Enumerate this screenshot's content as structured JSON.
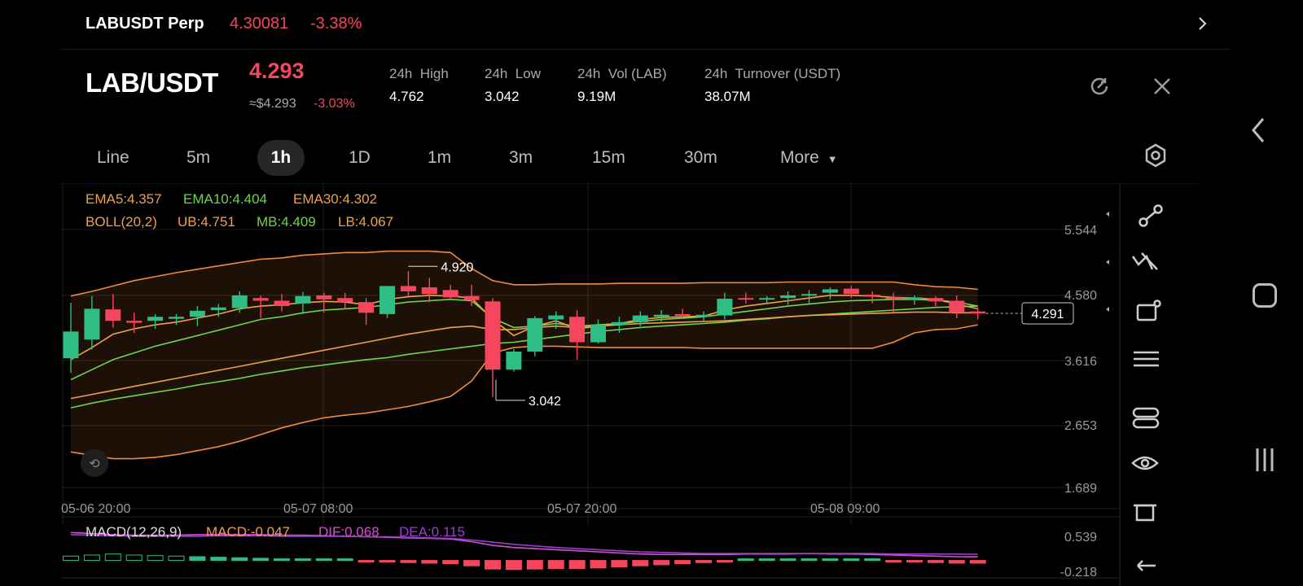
{
  "ticker": {
    "symbol": "LABUSDT Perp",
    "price": "4.30081",
    "change": "-3.38%"
  },
  "header": {
    "pair": "LAB/USDT",
    "last_price": "4.293",
    "approx_usd": "≈$4.293",
    "change": "-3.03%",
    "stats": [
      {
        "label": "24h  High",
        "value": "4.762"
      },
      {
        "label": "24h  Low",
        "value": "3.042"
      },
      {
        "label": "24h  Vol (LAB)",
        "value": "9.19M"
      },
      {
        "label": "24h  Turnover (USDT)",
        "value": "38.07M"
      }
    ]
  },
  "timeframes": [
    "Line",
    "5m",
    "1h",
    "1D",
    "1m",
    "3m",
    "15m",
    "30m",
    "More"
  ],
  "active_timeframe": "1h",
  "indicators": {
    "ema5": "EMA5:4.357",
    "ema10": "EMA10:4.404",
    "ema30": "EMA30:4.302",
    "boll": "BOLL(20,2)",
    "ub": "UB:4.751",
    "mb": "MB:4.409",
    "lb": "LB:4.067"
  },
  "macd": {
    "name": "MACD(12,26,9)",
    "macd": "MACD:-0.047",
    "dif": "DIF:0.068",
    "dea": "DEA:0.115"
  },
  "colors": {
    "up": "#2ebd85",
    "down": "#f6465d",
    "ema5": "#f0a04b",
    "ema10": "#6fd34d",
    "ema30": "#f0a04b",
    "boll": "#f08a3c",
    "dif": "#d24fd2",
    "dea": "#9a3fd0"
  },
  "chart_data": {
    "type": "candlestick",
    "y_axis_ticks": [
      "5.544",
      "4.580",
      "3.616",
      "2.653",
      "1.689"
    ],
    "ylim": [
      1.689,
      5.544
    ],
    "x_axis_ticks": [
      "05-06 20:00",
      "05-07 08:00",
      "05-07 20:00",
      "05-08 09:00"
    ],
    "current_price": "4.291",
    "high_marker": "4.920",
    "low_marker": "3.042",
    "macd_axis_ticks": [
      "0.539",
      "-0.218"
    ],
    "candles": [
      {
        "o": 3.62,
        "h": 4.45,
        "l": 3.4,
        "c": 4.02
      },
      {
        "o": 3.9,
        "h": 4.55,
        "l": 3.75,
        "c": 4.36
      },
      {
        "o": 4.35,
        "h": 4.58,
        "l": 4.08,
        "c": 4.18
      },
      {
        "o": 4.18,
        "h": 4.3,
        "l": 4.0,
        "c": 4.15
      },
      {
        "o": 4.18,
        "h": 4.28,
        "l": 4.06,
        "c": 4.24
      },
      {
        "o": 4.21,
        "h": 4.28,
        "l": 4.12,
        "c": 4.24
      },
      {
        "o": 4.24,
        "h": 4.4,
        "l": 4.1,
        "c": 4.33
      },
      {
        "o": 4.34,
        "h": 4.43,
        "l": 4.24,
        "c": 4.38
      },
      {
        "o": 4.37,
        "h": 4.62,
        "l": 4.3,
        "c": 4.56
      },
      {
        "o": 4.52,
        "h": 4.56,
        "l": 4.22,
        "c": 4.48
      },
      {
        "o": 4.48,
        "h": 4.58,
        "l": 4.32,
        "c": 4.4
      },
      {
        "o": 4.44,
        "h": 4.61,
        "l": 4.28,
        "c": 4.55
      },
      {
        "o": 4.56,
        "h": 4.6,
        "l": 4.3,
        "c": 4.5
      },
      {
        "o": 4.52,
        "h": 4.6,
        "l": 4.36,
        "c": 4.46
      },
      {
        "o": 4.46,
        "h": 4.52,
        "l": 4.12,
        "c": 4.3
      },
      {
        "o": 4.28,
        "h": 4.7,
        "l": 4.22,
        "c": 4.7
      },
      {
        "o": 4.7,
        "h": 4.92,
        "l": 4.55,
        "c": 4.62
      },
      {
        "o": 4.68,
        "h": 4.82,
        "l": 4.46,
        "c": 4.58
      },
      {
        "o": 4.64,
        "h": 4.72,
        "l": 4.5,
        "c": 4.53
      },
      {
        "o": 4.55,
        "h": 4.72,
        "l": 4.4,
        "c": 4.49
      },
      {
        "o": 4.47,
        "h": 4.52,
        "l": 3.04,
        "c": 3.45
      },
      {
        "o": 3.45,
        "h": 3.76,
        "l": 3.42,
        "c": 3.72
      },
      {
        "o": 3.72,
        "h": 4.25,
        "l": 3.65,
        "c": 4.22
      },
      {
        "o": 4.2,
        "h": 4.32,
        "l": 4.06,
        "c": 4.26
      },
      {
        "o": 4.24,
        "h": 4.34,
        "l": 3.6,
        "c": 3.86
      },
      {
        "o": 3.86,
        "h": 4.2,
        "l": 3.84,
        "c": 4.12
      },
      {
        "o": 4.12,
        "h": 4.24,
        "l": 4.0,
        "c": 4.16
      },
      {
        "o": 4.16,
        "h": 4.32,
        "l": 4.1,
        "c": 4.26
      },
      {
        "o": 4.24,
        "h": 4.34,
        "l": 4.17,
        "c": 4.27
      },
      {
        "o": 4.28,
        "h": 4.36,
        "l": 4.22,
        "c": 4.26
      },
      {
        "o": 4.24,
        "h": 4.32,
        "l": 4.18,
        "c": 4.27
      },
      {
        "o": 4.26,
        "h": 4.6,
        "l": 4.2,
        "c": 4.51
      },
      {
        "o": 4.52,
        "h": 4.6,
        "l": 4.44,
        "c": 4.5
      },
      {
        "o": 4.51,
        "h": 4.55,
        "l": 4.44,
        "c": 4.52
      },
      {
        "o": 4.52,
        "h": 4.62,
        "l": 4.42,
        "c": 4.56
      },
      {
        "o": 4.56,
        "h": 4.64,
        "l": 4.44,
        "c": 4.58
      },
      {
        "o": 4.6,
        "h": 4.68,
        "l": 4.5,
        "c": 4.65
      },
      {
        "o": 4.66,
        "h": 4.7,
        "l": 4.52,
        "c": 4.58
      },
      {
        "o": 4.57,
        "h": 4.62,
        "l": 4.44,
        "c": 4.54
      },
      {
        "o": 4.53,
        "h": 4.6,
        "l": 4.3,
        "c": 4.51
      },
      {
        "o": 4.5,
        "h": 4.56,
        "l": 4.42,
        "c": 4.53
      },
      {
        "o": 4.52,
        "h": 4.55,
        "l": 4.4,
        "c": 4.47
      },
      {
        "o": 4.48,
        "h": 4.56,
        "l": 4.22,
        "c": 4.3
      },
      {
        "o": 4.32,
        "h": 4.38,
        "l": 4.2,
        "c": 4.29
      }
    ],
    "series": [
      {
        "name": "BOLL UB",
        "values": [
          4.55,
          4.62,
          4.7,
          4.78,
          4.84,
          4.9,
          4.95,
          5.0,
          5.05,
          5.1,
          5.12,
          5.16,
          5.18,
          5.2,
          5.2,
          5.22,
          5.22,
          5.22,
          5.2,
          4.96,
          4.78,
          4.72,
          4.72,
          4.73,
          4.73,
          4.73,
          4.74,
          4.74,
          4.74,
          4.74,
          4.75,
          4.75,
          4.75,
          4.75,
          4.76,
          4.76,
          4.76,
          4.76,
          4.76,
          4.76,
          4.72,
          4.69,
          4.68,
          4.65
        ]
      },
      {
        "name": "BOLL LB",
        "values": [
          2.22,
          2.17,
          2.12,
          2.12,
          2.14,
          2.18,
          2.24,
          2.3,
          2.38,
          2.48,
          2.58,
          2.66,
          2.73,
          2.77,
          2.8,
          2.85,
          2.9,
          2.97,
          3.05,
          3.28,
          3.7,
          3.78,
          3.8,
          3.8,
          3.79,
          3.78,
          3.78,
          3.78,
          3.78,
          3.78,
          3.77,
          3.77,
          3.77,
          3.77,
          3.77,
          3.77,
          3.77,
          3.77,
          3.77,
          3.86,
          4.0,
          4.05,
          4.06,
          4.12
        ]
      },
      {
        "name": "MB",
        "values": [
          2.88,
          2.95,
          3.01,
          3.06,
          3.11,
          3.16,
          3.22,
          3.27,
          3.32,
          3.38,
          3.43,
          3.48,
          3.52,
          3.56,
          3.6,
          3.63,
          3.68,
          3.72,
          3.76,
          3.8,
          3.84,
          3.86,
          3.9,
          3.94,
          3.98,
          4.02,
          4.05,
          4.08,
          4.1,
          4.12,
          4.14,
          4.16,
          4.19,
          4.21,
          4.24,
          4.26,
          4.28,
          4.3,
          4.32,
          4.34,
          4.36,
          4.38,
          4.39,
          4.4
        ]
      },
      {
        "name": "EMA30",
        "values": [
          3.02,
          3.08,
          3.14,
          3.2,
          3.26,
          3.32,
          3.38,
          3.44,
          3.5,
          3.56,
          3.62,
          3.68,
          3.74,
          3.8,
          3.86,
          3.92,
          3.98,
          4.03,
          4.08,
          4.1,
          4.05,
          4.05,
          4.08,
          4.1,
          4.08,
          4.1,
          4.12,
          4.14,
          4.15,
          4.16,
          4.17,
          4.18,
          4.2,
          4.22,
          4.24,
          4.26,
          4.27,
          4.28,
          4.29,
          4.3,
          4.31,
          4.31,
          4.3,
          4.3
        ]
      },
      {
        "name": "EMA10",
        "values": [
          3.3,
          3.45,
          3.6,
          3.7,
          3.8,
          3.88,
          3.96,
          4.04,
          4.12,
          4.2,
          4.24,
          4.3,
          4.34,
          4.36,
          4.38,
          4.42,
          4.46,
          4.48,
          4.5,
          4.48,
          4.22,
          4.08,
          4.1,
          4.14,
          4.1,
          4.12,
          4.14,
          4.17,
          4.2,
          4.22,
          4.24,
          4.28,
          4.32,
          4.36,
          4.4,
          4.43,
          4.46,
          4.48,
          4.49,
          4.5,
          4.5,
          4.49,
          4.46,
          4.4
        ]
      },
      {
        "name": "EMA5",
        "values": [
          3.6,
          3.78,
          3.98,
          4.06,
          4.12,
          4.16,
          4.22,
          4.28,
          4.36,
          4.4,
          4.42,
          4.45,
          4.47,
          4.46,
          4.42,
          4.5,
          4.54,
          4.56,
          4.55,
          4.52,
          4.2,
          3.96,
          4.1,
          4.18,
          4.06,
          4.1,
          4.14,
          4.2,
          4.23,
          4.24,
          4.25,
          4.34,
          4.4,
          4.44,
          4.48,
          4.52,
          4.56,
          4.56,
          4.55,
          4.53,
          4.52,
          4.5,
          4.43,
          4.36
        ]
      }
    ],
    "macd_hist": [
      0.08,
      0.1,
      0.12,
      0.1,
      0.09,
      0.08,
      0.07,
      0.06,
      0.05,
      0.04,
      0.03,
      0.02,
      0.01,
      0.0,
      -0.02,
      -0.03,
      -0.04,
      -0.05,
      -0.06,
      -0.1,
      -0.16,
      -0.17,
      -0.16,
      -0.15,
      -0.15,
      -0.14,
      -0.12,
      -0.1,
      -0.08,
      -0.06,
      -0.04,
      -0.02,
      0.0,
      0.02,
      0.02,
      0.02,
      0.02,
      0.02,
      0.0,
      -0.02,
      -0.03,
      -0.04,
      -0.05,
      -0.05
    ],
    "dif": [
      0.52,
      0.5,
      0.48,
      0.47,
      0.47,
      0.47,
      0.48,
      0.48,
      0.48,
      0.48,
      0.47,
      0.47,
      0.46,
      0.45,
      0.44,
      0.43,
      0.42,
      0.41,
      0.4,
      0.35,
      0.28,
      0.24,
      0.22,
      0.2,
      0.18,
      0.16,
      0.14,
      0.12,
      0.11,
      0.11,
      0.11,
      0.11,
      0.12,
      0.12,
      0.12,
      0.13,
      0.12,
      0.12,
      0.11,
      0.1,
      0.09,
      0.08,
      0.07,
      0.068
    ],
    "dea": [
      0.48,
      0.47,
      0.46,
      0.45,
      0.45,
      0.45,
      0.45,
      0.46,
      0.46,
      0.46,
      0.45,
      0.45,
      0.45,
      0.45,
      0.44,
      0.44,
      0.43,
      0.42,
      0.41,
      0.38,
      0.34,
      0.3,
      0.27,
      0.24,
      0.22,
      0.2,
      0.18,
      0.16,
      0.15,
      0.14,
      0.13,
      0.13,
      0.13,
      0.13,
      0.13,
      0.13,
      0.13,
      0.13,
      0.13,
      0.12,
      0.12,
      0.12,
      0.118,
      0.115
    ]
  }
}
